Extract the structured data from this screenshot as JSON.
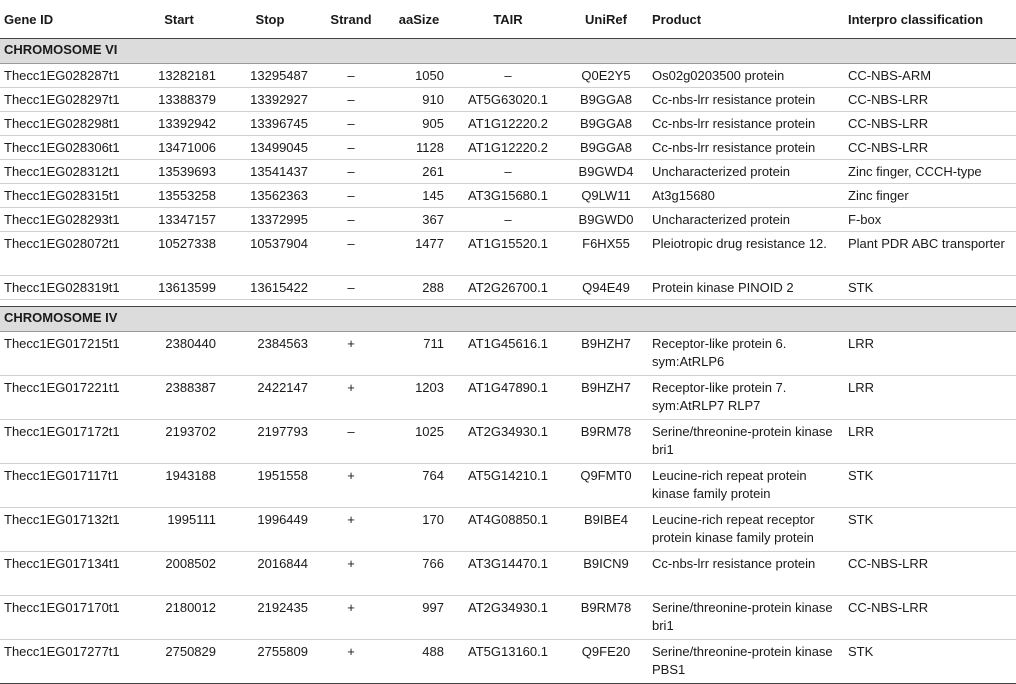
{
  "headers": [
    "Gene ID",
    "Start",
    "Stop",
    "Strand",
    "aaSize",
    "TAIR",
    "UniRef",
    "Product",
    "Interpro classification"
  ],
  "sections": [
    {
      "title": "CHROMOSOME VI",
      "rows": [
        [
          "Thecc1EG028287t1",
          "13282181",
          "13295487",
          "–",
          "1050",
          "–",
          "Q0E2Y5",
          "Os02g0203500 protein",
          "CC-NBS-ARM"
        ],
        [
          "Thecc1EG028297t1",
          "13388379",
          "13392927",
          "–",
          "910",
          "AT5G63020.1",
          "B9GGA8",
          "Cc-nbs-lrr resistance protein",
          "CC-NBS-LRR"
        ],
        [
          "Thecc1EG028298t1",
          "13392942",
          "13396745",
          "–",
          "905",
          "AT1G12220.2",
          "B9GGA8",
          "Cc-nbs-lrr resistance protein",
          "CC-NBS-LRR"
        ],
        [
          "Thecc1EG028306t1",
          "13471006",
          "13499045",
          "–",
          "1128",
          "AT1G12220.2",
          "B9GGA8",
          "Cc-nbs-lrr resistance protein",
          "CC-NBS-LRR"
        ],
        [
          "Thecc1EG028312t1",
          "13539693",
          "13541437",
          "–",
          "261",
          "–",
          "B9GWD4",
          "Uncharacterized protein",
          "Zinc finger, CCCH-type"
        ],
        [
          "Thecc1EG028315t1",
          "13553258",
          "13562363",
          "–",
          "145",
          "AT3G15680.1",
          "Q9LW11",
          "At3g15680",
          "Zinc finger"
        ],
        [
          "Thecc1EG028293t1",
          "13347157",
          "13372995",
          "–",
          "367",
          "–",
          "B9GWD0",
          "Uncharacterized protein",
          "F-box"
        ],
        [
          "Thecc1EG028072t1",
          "10527338",
          "10537904",
          "–",
          "1477",
          "AT1G15520.1",
          "F6HX55",
          "Pleiotropic drug resistance 12.",
          "Plant PDR ABC transporter"
        ],
        [
          "Thecc1EG028319t1",
          "13613599",
          "13615422",
          "–",
          "288",
          "AT2G26700.1",
          "Q94E49",
          "Protein kinase PINOID 2",
          "STK"
        ]
      ]
    },
    {
      "title": "CHROMOSOME IV",
      "rows": [
        [
          "Thecc1EG017215t1",
          "2380440",
          "2384563",
          "+",
          "711",
          "AT1G45616.1",
          "B9HZH7",
          "Receptor-like protein 6. sym:AtRLP6",
          "LRR"
        ],
        [
          "Thecc1EG017221t1",
          "2388387",
          "2422147",
          "+",
          "1203",
          "AT1G47890.1",
          "B9HZH7",
          "Receptor-like protein 7. sym:AtRLP7 RLP7",
          "LRR"
        ],
        [
          "Thecc1EG017172t1",
          "2193702",
          "2197793",
          "–",
          "1025",
          "AT2G34930.1",
          "B9RM78",
          "Serine/threonine-protein kinase bri1",
          "LRR"
        ],
        [
          "Thecc1EG017117t1",
          "1943188",
          "1951558",
          "+",
          "764",
          "AT5G14210.1",
          "Q9FMT0",
          "Leucine-rich repeat protein kinase family protein",
          "STK"
        ],
        [
          "Thecc1EG017132t1",
          "1995111",
          "1996449",
          "+",
          "170",
          "AT4G08850.1",
          "B9IBE4",
          "Leucine-rich repeat receptor protein kinase family protein",
          "STK"
        ],
        [
          "Thecc1EG017134t1",
          "2008502",
          "2016844",
          "+",
          "766",
          "AT3G14470.1",
          "B9ICN9",
          "Cc-nbs-lrr resistance protein",
          "CC-NBS-LRR"
        ],
        [
          "Thecc1EG017170t1",
          "2180012",
          "2192435",
          "+",
          "997",
          "AT2G34930.1",
          "B9RM78",
          "Serine/threonine-protein kinase bri1",
          "CC-NBS-LRR"
        ],
        [
          "Thecc1EG017277t1",
          "2750829",
          "2755809",
          "+",
          "488",
          "AT5G13160.1",
          "Q9FE20",
          "Serine/threonine-protein kinase PBS1",
          "STK"
        ]
      ]
    }
  ]
}
